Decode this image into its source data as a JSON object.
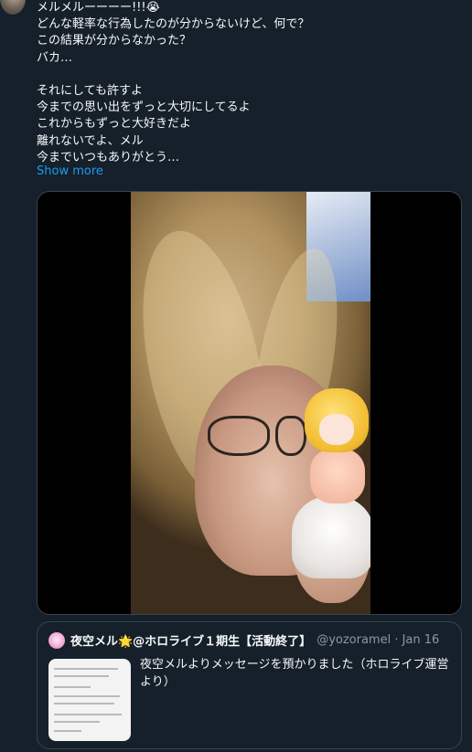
{
  "tweet": {
    "text": "メルメルーーーー!!!😭\nどんな軽率な行為したのが分からないけど、何で？\nこの結果が分からなかった？\nバカ…\n\nそれにしても許すよ\n今までの思い出をずっと大切にしてるよ\nこれからもずっと大好きだよ\n離れないでよ、メル\n今までいつもありがとう…",
    "show_more": "Show more"
  },
  "quoted": {
    "display_name": "夜空メル🌟@ホロライブ１期生【活動終了】",
    "handle_date": "@yozoramel · Jan 16",
    "text": "夜空メルよりメッセージを預かりました（ホロライブ運営より）"
  },
  "colors": {
    "background": "#15202b",
    "text": "#f7f9f9",
    "link": "#1d9bf0",
    "border": "#38444d",
    "muted": "#8b98a5"
  }
}
